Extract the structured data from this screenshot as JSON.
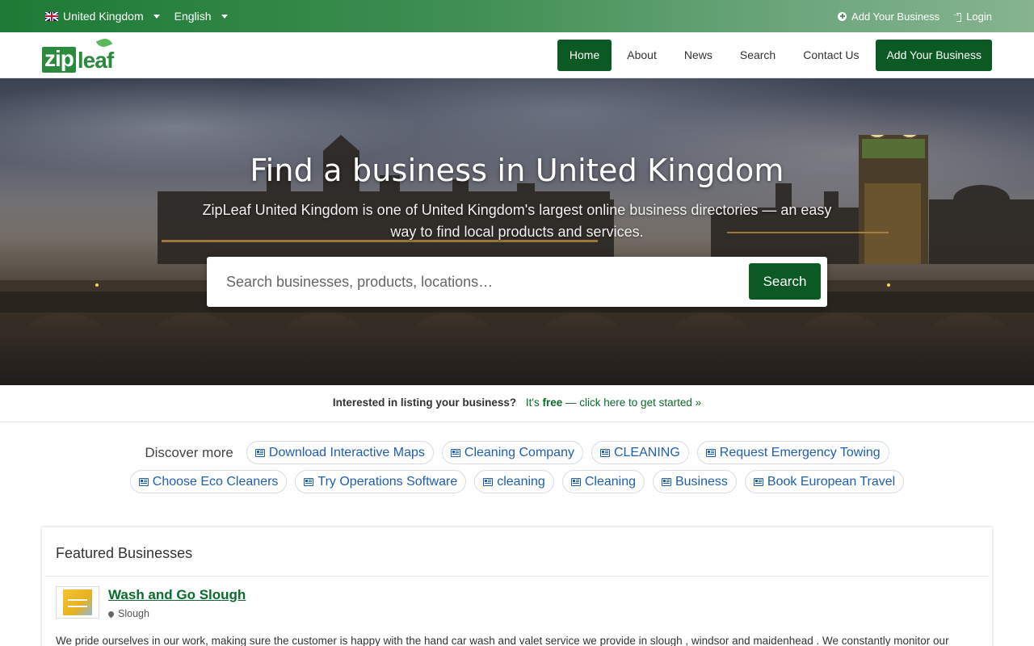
{
  "topbar": {
    "country": "United Kingdom",
    "language": "English",
    "add_business": "Add Your Business",
    "login": "Login"
  },
  "brand": {
    "logo_zip": "zip",
    "logo_leaf": "leaf",
    "color": "#0b5a23"
  },
  "nav": {
    "home": "Home",
    "about": "About",
    "news": "News",
    "search": "Search",
    "contact": "Contact Us",
    "add_business": "Add Your Business"
  },
  "hero": {
    "title": "Find a business in United Kingdom",
    "subtitle": "ZipLeaf United Kingdom is one of United Kingdom's largest online business directories — an easy way to find local products and services.",
    "search_placeholder": "Search businesses, products, locations…",
    "search_button": "Search"
  },
  "promo": {
    "question": "Interested in listing your business?",
    "link_prefix": "It's ",
    "link_bold": "free",
    "link_suffix": " — click here to get started »"
  },
  "discover": {
    "label": "Discover more",
    "row1": [
      "Download Interactive Maps",
      "Cleaning Company",
      "CLEANING",
      "Request Emergency Towing"
    ],
    "row2": [
      "Choose Eco Cleaners",
      "Try Operations Software",
      "cleaning",
      "Cleaning",
      "Business",
      "Book European Travel"
    ]
  },
  "featured": {
    "heading": "Featured Businesses",
    "business": {
      "name": "Wash and Go Slough",
      "location": "Slough",
      "description": "We pride ourselves in our work, making sure the customer is happy with the hand car wash and valet service we provide in slough , windsor and maidenhead . We constantly monitor our"
    }
  }
}
